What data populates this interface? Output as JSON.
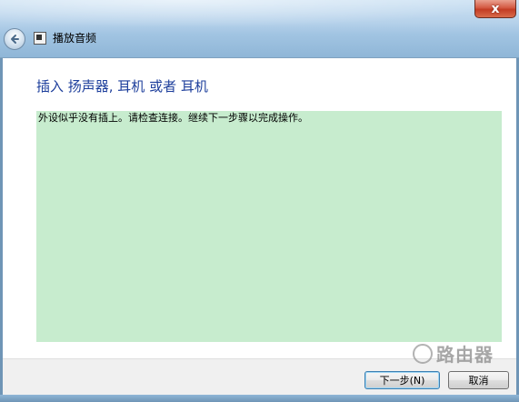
{
  "window": {
    "title": "播放音频",
    "close_label": "x"
  },
  "main": {
    "heading": "插入 扬声器, 耳机 或者 耳机",
    "message": "外设似乎没有插上。请检查连接。继续下一步骤以完成操作。"
  },
  "footer": {
    "next_label": "下一步(N)",
    "cancel_label": "取消"
  },
  "watermark": {
    "text": "路由器"
  },
  "colors": {
    "heading": "#1e3f9c",
    "notice_bg": "#c7ecce",
    "close_btn": "#c33c24"
  }
}
